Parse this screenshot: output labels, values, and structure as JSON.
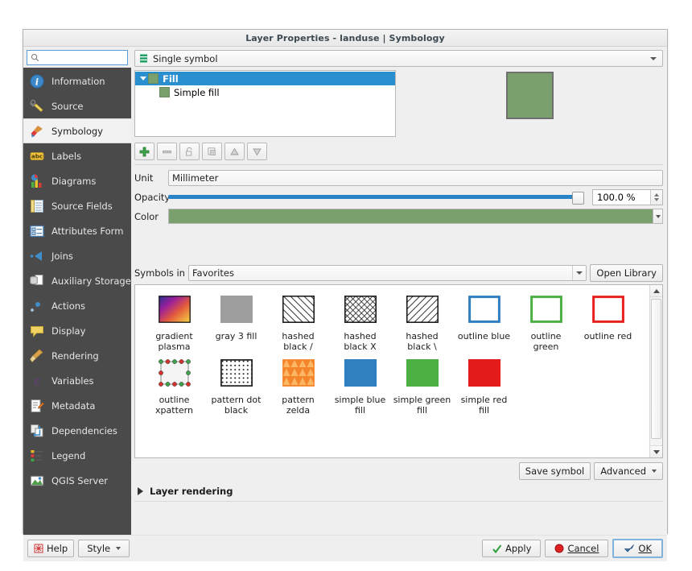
{
  "window": {
    "title": "Layer Properties - landuse | Symbology"
  },
  "sidebar": {
    "search": {
      "placeholder": "",
      "value": ""
    },
    "items": [
      {
        "label": "Information",
        "icon": "information-icon",
        "active": false
      },
      {
        "label": "Source",
        "icon": "source-icon",
        "active": false
      },
      {
        "label": "Symbology",
        "icon": "symbology-brush-icon",
        "active": true
      },
      {
        "label": "Labels",
        "icon": "labels-abc-icon",
        "active": false
      },
      {
        "label": "Diagrams",
        "icon": "diagrams-chart-icon",
        "active": false
      },
      {
        "label": "Source Fields",
        "icon": "source-fields-icon",
        "active": false
      },
      {
        "label": "Attributes Form",
        "icon": "attributes-form-icon",
        "active": false
      },
      {
        "label": "Joins",
        "icon": "joins-icon",
        "active": false
      },
      {
        "label": "Auxiliary Storage",
        "icon": "auxiliary-storage-icon",
        "active": false
      },
      {
        "label": "Actions",
        "icon": "actions-gear-icon",
        "active": false
      },
      {
        "label": "Display",
        "icon": "display-balloon-icon",
        "active": false
      },
      {
        "label": "Rendering",
        "icon": "rendering-broom-icon",
        "active": false
      },
      {
        "label": "Variables",
        "icon": "variables-epsilon-icon",
        "active": false
      },
      {
        "label": "Metadata",
        "icon": "metadata-pencil-icon",
        "active": false
      },
      {
        "label": "Dependencies",
        "icon": "dependencies-icon",
        "active": false
      },
      {
        "label": "Legend",
        "icon": "legend-icon",
        "active": false
      },
      {
        "label": "QGIS Server",
        "icon": "qgis-server-icon",
        "active": false
      }
    ]
  },
  "renderer": {
    "selected": "Single symbol"
  },
  "symbol_tree": {
    "parent": {
      "label": "Fill",
      "color": "#7aa06e"
    },
    "child": {
      "label": "Simple fill",
      "color": "#7aa06e"
    }
  },
  "preview": {
    "color": "#7aa06e"
  },
  "layer_toolbar": [
    {
      "name": "add-symbol-layer-button",
      "icon": "plus-icon"
    },
    {
      "name": "remove-symbol-layer-button",
      "icon": "minus-icon"
    },
    {
      "name": "lock-layer-button",
      "icon": "lock-icon"
    },
    {
      "name": "duplicate-layer-button",
      "icon": "copy-icon"
    },
    {
      "name": "move-up-button",
      "icon": "arrow-up-icon"
    },
    {
      "name": "move-down-button",
      "icon": "arrow-down-icon"
    }
  ],
  "properties": {
    "unit_label": "Unit",
    "unit_value": "Millimeter",
    "opacity_label": "Opacity",
    "opacity_value": "100.0 %",
    "opacity_percent": 100,
    "color_label": "Color",
    "color_value": "#7aa06e"
  },
  "library": {
    "symbols_in_label": "Symbols in",
    "group_value": "Favorites",
    "open_library_label": "Open Library",
    "symbols": [
      {
        "name": "gradient plasma",
        "kind": "gradient-plasma"
      },
      {
        "name": "gray 3 fill",
        "kind": "solid",
        "color": "#9e9e9e"
      },
      {
        "name": "hashed black /",
        "kind": "hatch-forward"
      },
      {
        "name": "hashed black X",
        "kind": "hatch-cross"
      },
      {
        "name": "hashed black \\",
        "kind": "hatch-back"
      },
      {
        "name": "outline blue",
        "kind": "outline",
        "color": "#2f7fc1"
      },
      {
        "name": "outline green",
        "kind": "outline",
        "color": "#4caf42"
      },
      {
        "name": "outline red",
        "kind": "outline",
        "color": "#e8201f"
      },
      {
        "name": "outline xpattern",
        "kind": "xpattern"
      },
      {
        "name": "pattern dot black",
        "kind": "dots"
      },
      {
        "name": "pattern zelda",
        "kind": "zelda"
      },
      {
        "name": "simple blue fill",
        "kind": "solid",
        "color": "#2f7fc1"
      },
      {
        "name": "simple green fill",
        "kind": "solid",
        "color": "#4caf42"
      },
      {
        "name": "simple red fill",
        "kind": "solid",
        "color": "#e31b1b"
      }
    ]
  },
  "actions": {
    "save_symbol_label": "Save symbol",
    "advanced_label": "Advanced",
    "layer_rendering_label": "Layer rendering"
  },
  "footer": {
    "help_label": "Help",
    "style_label": "Style",
    "apply_label": "Apply",
    "cancel_label": "Cancel",
    "ok_label": "OK"
  },
  "colors": {
    "accent_blue": "#2a8fce",
    "sidebar_bg": "#4a4a4a",
    "symbol_green": "#7aa06e"
  }
}
